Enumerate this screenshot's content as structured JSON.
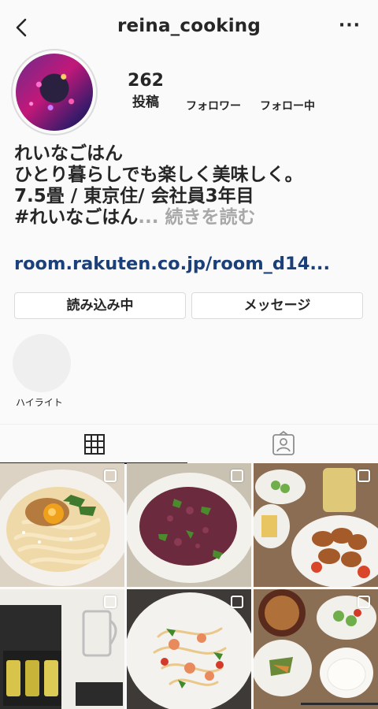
{
  "header": {
    "username": "reina_cooking",
    "back_icon": "chevron-left-icon",
    "more_icon": "more-horizontal-icon",
    "more_glyph": "···"
  },
  "profile": {
    "posts_count": "262",
    "posts_label": "投稿",
    "followers_label": "フォロワー",
    "following_label": "フォロー中"
  },
  "bio": {
    "line1": "れいなごはん",
    "line2": "ひとり暮らしでも楽しく美味しく。",
    "line3": "7.5畳 / 東京住/  会社員3年目",
    "line4": "#れいなごはん",
    "more_text": "... 続きを読む",
    "link": "room.rakuten.co.jp/room_d14..."
  },
  "buttons": {
    "loading_label": "読み込み中",
    "message_label": "メッセージ"
  },
  "highlights": {
    "label": "ハイライト"
  },
  "tabs": {
    "grid_icon": "grid-icon",
    "tagged_icon": "tagged-person-icon",
    "active": "grid"
  },
  "posts": [
    {
      "name": "carbonara-udon",
      "multiple": true
    },
    {
      "name": "beet-risotto",
      "multiple": true
    },
    {
      "name": "yakitori-dinner",
      "multiple": true
    },
    {
      "name": "sake-gift-set",
      "multiple": true
    },
    {
      "name": "salmon-pasta",
      "multiple": true
    },
    {
      "name": "miso-soup-set",
      "multiple": true
    }
  ]
}
